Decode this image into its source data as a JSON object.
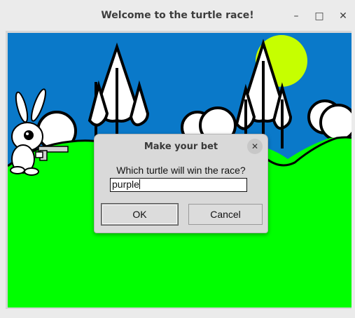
{
  "window": {
    "title": "Welcome to the turtle race!",
    "minimize_glyph": "–",
    "maximize_glyph": "□",
    "close_glyph": "✕"
  },
  "scene": {
    "sky_color": "#0a79c9",
    "grass_color": "#00ff00",
    "sun_color": "#c6ff00"
  },
  "dialog": {
    "title": "Make your bet",
    "close_glyph": "✕",
    "prompt": "Which turtle will win the race?",
    "answer_value": "purple",
    "ok_label": "OK",
    "cancel_label": "Cancel"
  }
}
